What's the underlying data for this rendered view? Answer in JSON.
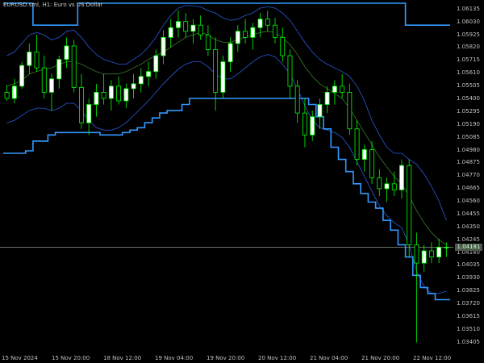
{
  "title": "EURUSD.sml, H1:  Euro vs US Dollar",
  "current_price": "1.04181",
  "colors": {
    "background": "#000000",
    "bull": "#00ff00",
    "bear": "#00ff00",
    "bull_fill": "#ffffff",
    "outer_channel": "#3399ff",
    "inner_bands": "#2a5ad8",
    "ma_line": "#3a7a2a",
    "axis_text": "#c0c0c0"
  },
  "y_ticks": [
    "1.06135",
    "1.06030",
    "1.05925",
    "1.05820",
    "1.05715",
    "1.05610",
    "1.05505",
    "1.05400",
    "1.05295",
    "1.05190",
    "1.05085",
    "1.04980",
    "1.04875",
    "1.04770",
    "1.04665",
    "1.04560",
    "1.04455",
    "1.04350",
    "1.04245",
    "1.04140",
    "1.04035",
    "1.03930",
    "1.03825",
    "1.03720",
    "1.03615",
    "1.03510",
    "1.03405"
  ],
  "x_ticks": [
    "15 Nov 2024",
    "15 Nov 20:00",
    "18 Nov 12:00",
    "19 Nov 04:00",
    "19 Nov 20:00",
    "20 Nov 12:00",
    "21 Nov 04:00",
    "21 Nov 20:00",
    "22 Nov 12:00"
  ],
  "chart_data": {
    "type": "candlestick",
    "symbol": "EURUSD.sml",
    "timeframe": "H1",
    "ylim": [
      1.0335,
      1.0618
    ],
    "candles": [
      [
        1.0545,
        1.0551,
        1.0538,
        1.054
      ],
      [
        1.054,
        1.0556,
        1.0536,
        1.055
      ],
      [
        1.055,
        1.057,
        1.0548,
        1.0567
      ],
      [
        1.0567,
        1.0585,
        1.056,
        1.0578
      ],
      [
        1.0578,
        1.0592,
        1.0562,
        1.0565
      ],
      [
        1.0565,
        1.0575,
        1.054,
        1.0545
      ],
      [
        1.0545,
        1.056,
        1.053,
        1.0556
      ],
      [
        1.0556,
        1.0575,
        1.0548,
        1.0572
      ],
      [
        1.0572,
        1.059,
        1.0565,
        1.0583
      ],
      [
        1.0583,
        1.0588,
        1.0545,
        1.0549
      ],
      [
        1.0549,
        1.056,
        1.0515,
        1.052
      ],
      [
        1.052,
        1.054,
        1.051,
        1.0535
      ],
      [
        1.0535,
        1.0552,
        1.0525,
        1.0545
      ],
      [
        1.0545,
        1.056,
        1.0535,
        1.054
      ],
      [
        1.054,
        1.0555,
        1.053,
        1.055
      ],
      [
        1.055,
        1.0558,
        1.0535,
        1.0538
      ],
      [
        1.0538,
        1.0552,
        1.0532,
        1.0548
      ],
      [
        1.0548,
        1.056,
        1.054,
        1.0552
      ],
      [
        1.0552,
        1.0565,
        1.0545,
        1.0558
      ],
      [
        1.0558,
        1.057,
        1.055,
        1.0562
      ],
      [
        1.0562,
        1.058,
        1.0556,
        1.0575
      ],
      [
        1.0575,
        1.0596,
        1.0568,
        1.059
      ],
      [
        1.059,
        1.0605,
        1.0582,
        1.0598
      ],
      [
        1.0598,
        1.0612,
        1.059,
        1.0603
      ],
      [
        1.0603,
        1.061,
        1.059,
        1.0595
      ],
      [
        1.0595,
        1.0605,
        1.0585,
        1.06
      ],
      [
        1.06,
        1.0608,
        1.0588,
        1.0592
      ],
      [
        1.0592,
        1.06,
        1.0575,
        1.058
      ],
      [
        1.058,
        1.059,
        1.053,
        1.0545
      ],
      [
        1.0545,
        1.0575,
        1.054,
        1.057
      ],
      [
        1.057,
        1.059,
        1.0562,
        1.0585
      ],
      [
        1.0585,
        1.06,
        1.0578,
        1.0595
      ],
      [
        1.0595,
        1.0605,
        1.0585,
        1.059
      ],
      [
        1.059,
        1.0602,
        1.058,
        1.0598
      ],
      [
        1.0598,
        1.061,
        1.059,
        1.0605
      ],
      [
        1.0605,
        1.0612,
        1.0595,
        1.06
      ],
      [
        1.06,
        1.0606,
        1.0585,
        1.059
      ],
      [
        1.059,
        1.0598,
        1.057,
        1.0575
      ],
      [
        1.0575,
        1.058,
        1.054,
        1.055
      ],
      [
        1.055,
        1.0555,
        1.052,
        1.0528
      ],
      [
        1.0528,
        1.054,
        1.05,
        1.051
      ],
      [
        1.051,
        1.053,
        1.0505,
        1.0525
      ],
      [
        1.0525,
        1.054,
        1.0515,
        1.0535
      ],
      [
        1.0535,
        1.055,
        1.0528,
        1.0545
      ],
      [
        1.0545,
        1.0555,
        1.0535,
        1.055
      ],
      [
        1.055,
        1.056,
        1.054,
        1.0545
      ],
      [
        1.0545,
        1.0552,
        1.051,
        1.0515
      ],
      [
        1.0515,
        1.0522,
        1.0485,
        1.049
      ],
      [
        1.049,
        1.0502,
        1.048,
        1.0498
      ],
      [
        1.0498,
        1.0505,
        1.047,
        1.0475
      ],
      [
        1.0475,
        1.0482,
        1.046,
        1.0466
      ],
      [
        1.0466,
        1.0475,
        1.0455,
        1.047
      ],
      [
        1.047,
        1.048,
        1.046,
        1.0465
      ],
      [
        1.0465,
        1.049,
        1.0458,
        1.0485
      ],
      [
        1.0485,
        1.049,
        1.041,
        1.042
      ],
      [
        1.042,
        1.043,
        1.034,
        1.0405
      ],
      [
        1.0405,
        1.042,
        1.0398,
        1.0415
      ],
      [
        1.0415,
        1.0422,
        1.0405,
        1.041
      ],
      [
        1.041,
        1.0425,
        1.0405,
        1.0418
      ],
      [
        1.0418,
        1.0422,
        1.041,
        1.0418
      ]
    ],
    "outer_channel_upper": [
      1.0618,
      1.0618,
      1.0618,
      1.0618,
      1.06,
      1.06,
      1.06,
      1.06,
      1.06,
      1.06,
      1.0618,
      1.0618,
      1.0618,
      1.0618,
      1.0618,
      1.0618,
      1.0618,
      1.0618,
      1.0618,
      1.0618,
      1.0618,
      1.0618,
      1.0618,
      1.0618,
      1.0618,
      1.0618,
      1.0618,
      1.0618,
      1.0618,
      1.0618,
      1.0618,
      1.0618,
      1.0618,
      1.0618,
      1.0618,
      1.0618,
      1.0618,
      1.0618,
      1.0618,
      1.0618,
      1.0618,
      1.0618,
      1.0618,
      1.0618,
      1.0618,
      1.0618,
      1.0618,
      1.0618,
      1.0618,
      1.0618,
      1.0618,
      1.0618,
      1.0618,
      1.0618,
      1.06,
      1.06,
      1.06,
      1.06,
      1.06,
      1.06
    ],
    "outer_channel_lower": [
      1.0495,
      1.0495,
      1.0495,
      1.0497,
      1.0505,
      1.0505,
      1.051,
      1.0512,
      1.0512,
      1.0512,
      1.0512,
      1.0512,
      1.0512,
      1.051,
      1.051,
      1.051,
      1.0512,
      1.0514,
      1.0516,
      1.052,
      1.0524,
      1.0528,
      1.053,
      1.053,
      1.0535,
      1.054,
      1.054,
      1.054,
      1.054,
      1.054,
      1.054,
      1.054,
      1.054,
      1.054,
      1.054,
      1.054,
      1.054,
      1.054,
      1.054,
      1.054,
      1.054,
      1.0535,
      1.0525,
      1.0515,
      1.05,
      1.049,
      1.048,
      1.047,
      1.0462,
      1.0455,
      1.045,
      1.044,
      1.0432,
      1.042,
      1.041,
      1.0395,
      1.0385,
      1.038,
      1.0375,
      1.0375
    ],
    "ma_line": [
      1.055,
      1.0552,
      1.0555,
      1.056,
      1.0562,
      1.0564,
      1.0565,
      1.0568,
      1.057,
      1.057,
      1.0568,
      1.0565,
      1.0562,
      1.056,
      1.056,
      1.056,
      1.0562,
      1.0565,
      1.0568,
      1.0572,
      1.0575,
      1.0578,
      1.0582,
      1.0586,
      1.059,
      1.0592,
      1.0594,
      1.0592,
      1.0588,
      1.0586,
      1.0586,
      1.0588,
      1.059,
      1.0592,
      1.0594,
      1.0595,
      1.0594,
      1.059,
      1.0584,
      1.0576,
      1.0566,
      1.0558,
      1.0552,
      1.0548,
      1.0544,
      1.054,
      1.0532,
      1.0522,
      1.0512,
      1.0502,
      1.0492,
      1.0484,
      1.0476,
      1.047,
      1.046,
      1.0448,
      1.0438,
      1.043,
      1.0424,
      1.042
    ],
    "inner_band_upper": [
      1.0575,
      1.0578,
      1.0585,
      1.0592,
      1.0594,
      1.0592,
      1.0588,
      1.059,
      1.0595,
      1.0596,
      1.059,
      1.0582,
      1.0576,
      1.0572,
      1.057,
      1.0568,
      1.0568,
      1.0572,
      1.0576,
      1.0582,
      1.059,
      1.06,
      1.0608,
      1.0614,
      1.0616,
      1.0616,
      1.0615,
      1.0612,
      1.061,
      1.0606,
      1.0604,
      1.0605,
      1.0608,
      1.061,
      1.0614,
      1.0615,
      1.0614,
      1.061,
      1.0604,
      1.0595,
      1.0586,
      1.0578,
      1.0572,
      1.0568,
      1.0565,
      1.0562,
      1.0558,
      1.055,
      1.0538,
      1.0522,
      1.051,
      1.05,
      1.0495,
      1.0495,
      1.049,
      1.0486,
      1.0478,
      1.0468,
      1.0456,
      1.044
    ],
    "inner_band_lower": [
      1.052,
      1.0522,
      1.0526,
      1.053,
      1.0532,
      1.0532,
      1.053,
      1.0532,
      1.0536,
      1.0536,
      1.053,
      1.0522,
      1.0516,
      1.0514,
      1.0514,
      1.0516,
      1.052,
      1.0526,
      1.0532,
      1.0538,
      1.0545,
      1.0552,
      1.0558,
      1.0564,
      1.0568,
      1.057,
      1.057,
      1.0566,
      1.056,
      1.0556,
      1.0556,
      1.056,
      1.0565,
      1.057,
      1.0574,
      1.0576,
      1.0574,
      1.0568,
      1.056,
      1.0548,
      1.0534,
      1.0522,
      1.0516,
      1.0514,
      1.0512,
      1.0508,
      1.05,
      1.0488,
      1.0476,
      1.0464,
      1.0452,
      1.0444,
      1.0438,
      1.0434,
      1.042,
      1.0398,
      1.0386,
      1.038,
      1.038,
      1.0382
    ]
  }
}
